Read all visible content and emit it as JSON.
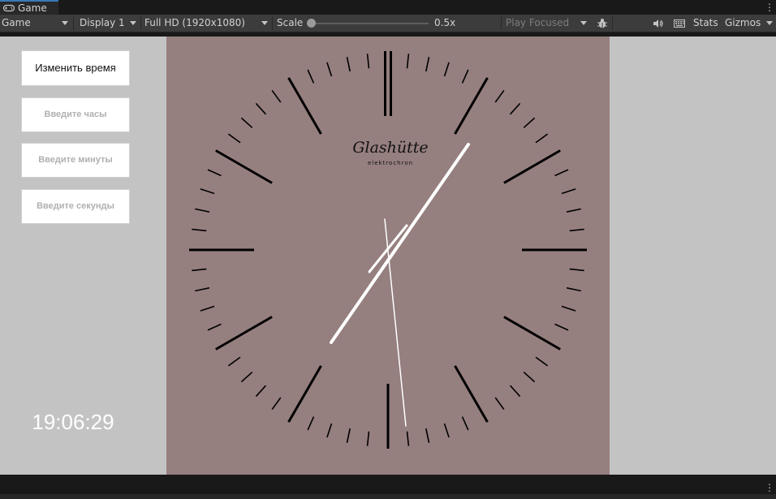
{
  "tab": {
    "label": "Game",
    "icon": "gamepad-icon"
  },
  "toolbar": {
    "view_mode": "Game",
    "display": "Display 1",
    "resolution": "Full HD (1920x1080)",
    "scale_label": "Scale",
    "scale_value": "0.5x",
    "scale_level": 0.0,
    "play_mode": "Play Focused",
    "stats": "Stats",
    "gizmos": "Gizmos"
  },
  "controls": {
    "change_time_button": "Изменить время",
    "hours_placeholder": "Введите часы",
    "minutes_placeholder": "Введите минуты",
    "seconds_placeholder": "Введите секунды"
  },
  "clock": {
    "time_text": "19:06:29",
    "brand": "Glashütte",
    "sub_brand": "elektrochron",
    "hours": 19,
    "minutes": 6,
    "seconds": 29
  },
  "colors": {
    "dial": "#967f7f",
    "viewport": "#c3c3c3",
    "hands": "#ffffff",
    "markers": "#000000"
  }
}
